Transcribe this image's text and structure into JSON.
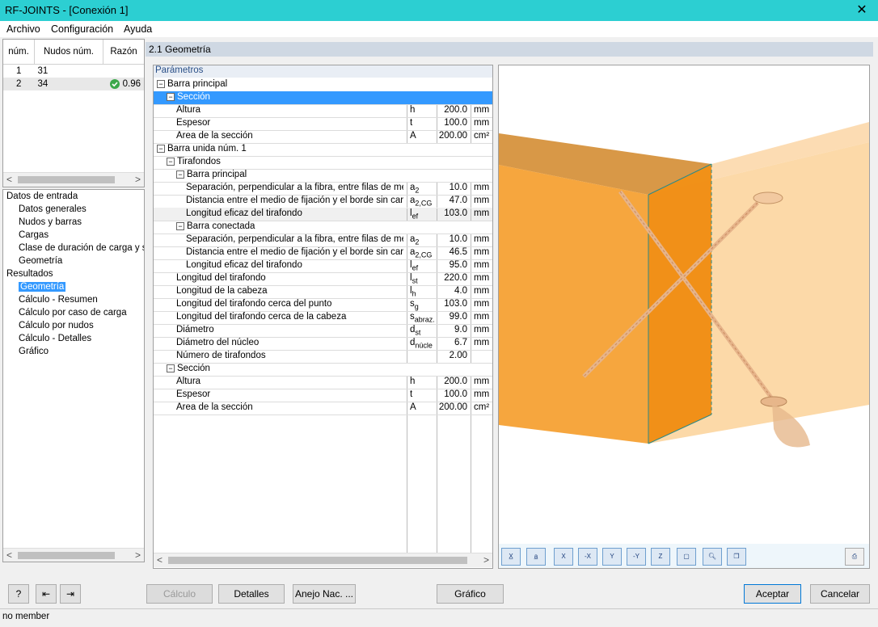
{
  "window": {
    "title": "RF-JOINTS - [Conexión 1]",
    "close_icon": "close-icon"
  },
  "menu": {
    "items": [
      "Archivo",
      "Configuración",
      "Ayuda"
    ]
  },
  "nodes_table": {
    "headers": [
      "núm.",
      "Nudos núm.",
      "Razón"
    ],
    "rows": [
      {
        "num": "1",
        "nudos": "31",
        "razon": ""
      },
      {
        "num": "2",
        "nudos": "34",
        "razon": "0.96",
        "status": "check-ok-icon"
      }
    ]
  },
  "nav_tree": {
    "groups": [
      {
        "label": "Datos de entrada",
        "items": [
          "Datos generales",
          "Nudos y barras",
          "Cargas",
          "Clase de duración de carga y se",
          "Geometría"
        ]
      },
      {
        "label": "Resultados",
        "items": [
          "Geometría",
          "Cálculo - Resumen",
          "Cálculo por caso de carga",
          "Cálculo por nudos",
          "Cálculo - Detalles",
          "Gráfico"
        ]
      }
    ],
    "selected": "Geometría"
  },
  "section_header": "2.1 Geometría",
  "params": {
    "title": "Parámetros",
    "rows": [
      {
        "label": "Barra principal",
        "level": 0,
        "expand": "−",
        "sym": "",
        "sub": "",
        "val": "",
        "unit": ""
      },
      {
        "label": "Sección",
        "level": 1,
        "expand": "−",
        "sym": "",
        "sub": "",
        "val": "",
        "unit": "",
        "selected": true
      },
      {
        "label": "Altura",
        "level": 2,
        "sym": "h",
        "sub": "",
        "val": "200.0",
        "unit": "mm"
      },
      {
        "label": "Espesor",
        "level": 2,
        "sym": "t",
        "sub": "",
        "val": "100.0",
        "unit": "mm"
      },
      {
        "label": "Área de la sección",
        "level": 2,
        "sym": "A",
        "sub": "",
        "val": "200.00",
        "unit": "cm²"
      },
      {
        "label": "Barra unida núm. 1",
        "level": 0,
        "expand": "−",
        "sym": "",
        "sub": "",
        "val": "",
        "unit": ""
      },
      {
        "label": "Tirafondos",
        "level": 1,
        "expand": "−",
        "sym": "",
        "sub": "",
        "val": "",
        "unit": ""
      },
      {
        "label": "Barra principal",
        "level": 2,
        "expand": "−",
        "sym": "",
        "sub": "",
        "val": "",
        "unit": ""
      },
      {
        "label": "Separación, perpendicular a la fibra, entre filas de med",
        "level": 3,
        "sym": "a",
        "sub": "2",
        "val": "10.0",
        "unit": "mm"
      },
      {
        "label": "Distancia entre el medio de fijación y el borde sin carga",
        "level": 3,
        "sym": "a",
        "sub": "2,CG",
        "val": "47.0",
        "unit": "mm"
      },
      {
        "label": "Longitud eficaz del tirafondo",
        "level": 3,
        "sym": "l",
        "sub": "ef",
        "val": "103.0",
        "unit": "mm",
        "highlight": true
      },
      {
        "label": "Barra conectada",
        "level": 2,
        "expand": "−",
        "sym": "",
        "sub": "",
        "val": "",
        "unit": ""
      },
      {
        "label": "Separación, perpendicular a la fibra, entre filas de med",
        "level": 3,
        "sym": "a",
        "sub": "2",
        "val": "10.0",
        "unit": "mm"
      },
      {
        "label": "Distancia entre el medio de fijación y el borde sin carga",
        "level": 3,
        "sym": "a",
        "sub": "2,CG",
        "val": "46.5",
        "unit": "mm"
      },
      {
        "label": "Longitud eficaz del tirafondo",
        "level": 3,
        "sym": "l",
        "sub": "ef",
        "val": "95.0",
        "unit": "mm"
      },
      {
        "label": "Longitud del tirafondo",
        "level": 2,
        "sym": "l",
        "sub": "st",
        "val": "220.0",
        "unit": "mm"
      },
      {
        "label": "Longitud de la cabeza",
        "level": 2,
        "sym": "l",
        "sub": "h",
        "val": "4.0",
        "unit": "mm"
      },
      {
        "label": "Longitud del tirafondo cerca del punto",
        "level": 2,
        "sym": "s",
        "sub": "g",
        "val": "103.0",
        "unit": "mm"
      },
      {
        "label": "Longitud del tirafondo cerca de la cabeza",
        "level": 2,
        "sym": "s",
        "sub": "abraz.",
        "val": "99.0",
        "unit": "mm"
      },
      {
        "label": "Diámetro",
        "level": 2,
        "sym": "d",
        "sub": "st",
        "val": "9.0",
        "unit": "mm"
      },
      {
        "label": "Diámetro del núcleo",
        "level": 2,
        "sym": "d",
        "sub": "núcle",
        "val": "6.7",
        "unit": "mm"
      },
      {
        "label": "Número de tirafondos",
        "level": 2,
        "sym": "",
        "sub": "",
        "val": "2.00",
        "unit": ""
      },
      {
        "label": "Sección",
        "level": 1,
        "expand": "−",
        "sym": "",
        "sub": "",
        "val": "",
        "unit": ""
      },
      {
        "label": "Altura",
        "level": 2,
        "sym": "h",
        "sub": "",
        "val": "200.0",
        "unit": "mm"
      },
      {
        "label": "Espesor",
        "level": 2,
        "sym": "t",
        "sub": "",
        "val": "100.0",
        "unit": "mm"
      },
      {
        "label": "Área de la sección",
        "level": 2,
        "sym": "A",
        "sub": "",
        "val": "200.00",
        "unit": "cm²"
      }
    ]
  },
  "graphic_toolbar": [
    "view-x-icon",
    "view-a-icon",
    "view-x-axis-icon",
    "view-neg-x-icon",
    "view-y-icon",
    "view-neg-y-icon",
    "view-z-icon",
    "iso-view-icon",
    "zoom-icon",
    "copy-icon",
    "print-icon"
  ],
  "buttons": {
    "calc": "Cálculo",
    "details": "Detalles",
    "annex": "Anejo Nac. ...",
    "graphic": "Gráfico",
    "accept": "Aceptar",
    "cancel": "Cancelar"
  },
  "status": "no member",
  "colors": {
    "accent": "#2ccfd2",
    "selection": "#3399ff",
    "timber": "#f59a23"
  }
}
